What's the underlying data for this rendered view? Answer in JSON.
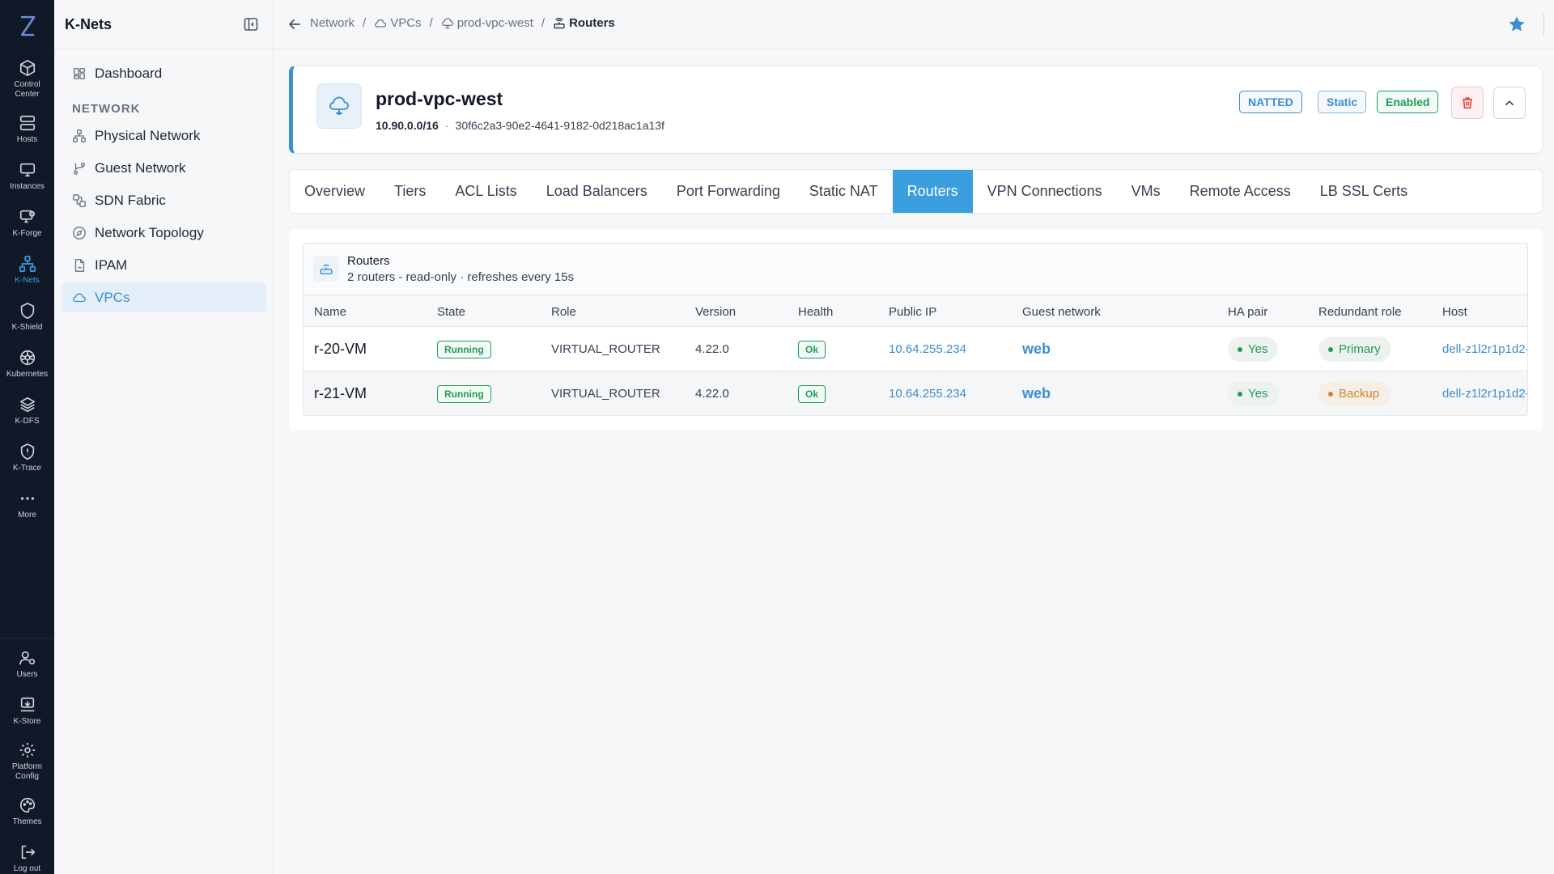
{
  "rail": {
    "items": [
      {
        "label": "Control Center",
        "icon": "cube-icon"
      },
      {
        "label": "Hosts",
        "icon": "server-icon"
      },
      {
        "label": "Instances",
        "icon": "monitor-icon"
      },
      {
        "label": "K-Forge",
        "icon": "forge-icon"
      },
      {
        "label": "K-Nets",
        "icon": "network-icon"
      },
      {
        "label": "K-Shield",
        "icon": "shield-icon"
      },
      {
        "label": "Kubernetes",
        "icon": "kubernetes-icon"
      },
      {
        "label": "K-DFS",
        "icon": "layers-icon"
      },
      {
        "label": "K-Trace",
        "icon": "trace-icon"
      },
      {
        "label": "More",
        "icon": "ellipsis-icon"
      }
    ],
    "bottom": [
      {
        "label": "Users",
        "icon": "users-icon"
      },
      {
        "label": "K-Store",
        "icon": "store-icon"
      },
      {
        "label": "Platform Config",
        "icon": "gear-icon"
      },
      {
        "label": "Themes",
        "icon": "palette-icon"
      },
      {
        "label": "Log out",
        "icon": "logout-icon"
      }
    ],
    "active": "K-Nets"
  },
  "sidebar": {
    "title": "K-Nets",
    "dashboard": "Dashboard",
    "section": "NETWORK",
    "items": [
      {
        "label": "Physical Network"
      },
      {
        "label": "Guest Network"
      },
      {
        "label": "SDN Fabric"
      },
      {
        "label": "Network Topology"
      },
      {
        "label": "IPAM"
      },
      {
        "label": "VPCs"
      }
    ],
    "active": "VPCs"
  },
  "breadcrumb": {
    "items": [
      "Network",
      "VPCs",
      "prod-vpc-west",
      "Routers"
    ],
    "separator": "/"
  },
  "vpc": {
    "name": "prod-vpc-west",
    "cidr": "10.90.0.0/16",
    "separator": "·",
    "id": "30f6c2a3-90e2-4641-9182-0d218ac1a13f",
    "badges": {
      "natted": "NATTED",
      "static": "Static",
      "enabled": "Enabled"
    }
  },
  "tabs": [
    "Overview",
    "Tiers",
    "ACL Lists",
    "Load Balancers",
    "Port Forwarding",
    "Static NAT",
    "Routers",
    "VPN Connections",
    "VMs",
    "Remote Access",
    "LB SSL Certs"
  ],
  "active_tab": "Routers",
  "routers": {
    "title": "Routers",
    "subtitle": "2 routers - read-only · refreshes every 15s",
    "columns": [
      "Name",
      "State",
      "Role",
      "Version",
      "Health",
      "Public IP",
      "Guest network",
      "HA pair",
      "Redundant role",
      "Host"
    ],
    "rows": [
      {
        "name": "r-20-VM",
        "state": "Running",
        "role": "VIRTUAL_ROUTER",
        "version": "4.22.0",
        "health": "Ok",
        "public_ip": "10.64.255.234",
        "guest_network": "web",
        "ha_pair": "Yes",
        "redundant_role": "Primary",
        "host": "dell-z1l2r1p1d2-"
      },
      {
        "name": "r-21-VM",
        "state": "Running",
        "role": "VIRTUAL_ROUTER",
        "version": "4.22.0",
        "health": "Ok",
        "public_ip": "10.64.255.234",
        "guest_network": "web",
        "ha_pair": "Yes",
        "redundant_role": "Backup",
        "host": "dell-z1l2r1p1d2-"
      }
    ]
  },
  "colors": {
    "accent": "#3b9ede",
    "rail_bg": "#111827",
    "success": "#1f9d55",
    "warning": "#d9822b",
    "danger": "#dc3b3b"
  }
}
